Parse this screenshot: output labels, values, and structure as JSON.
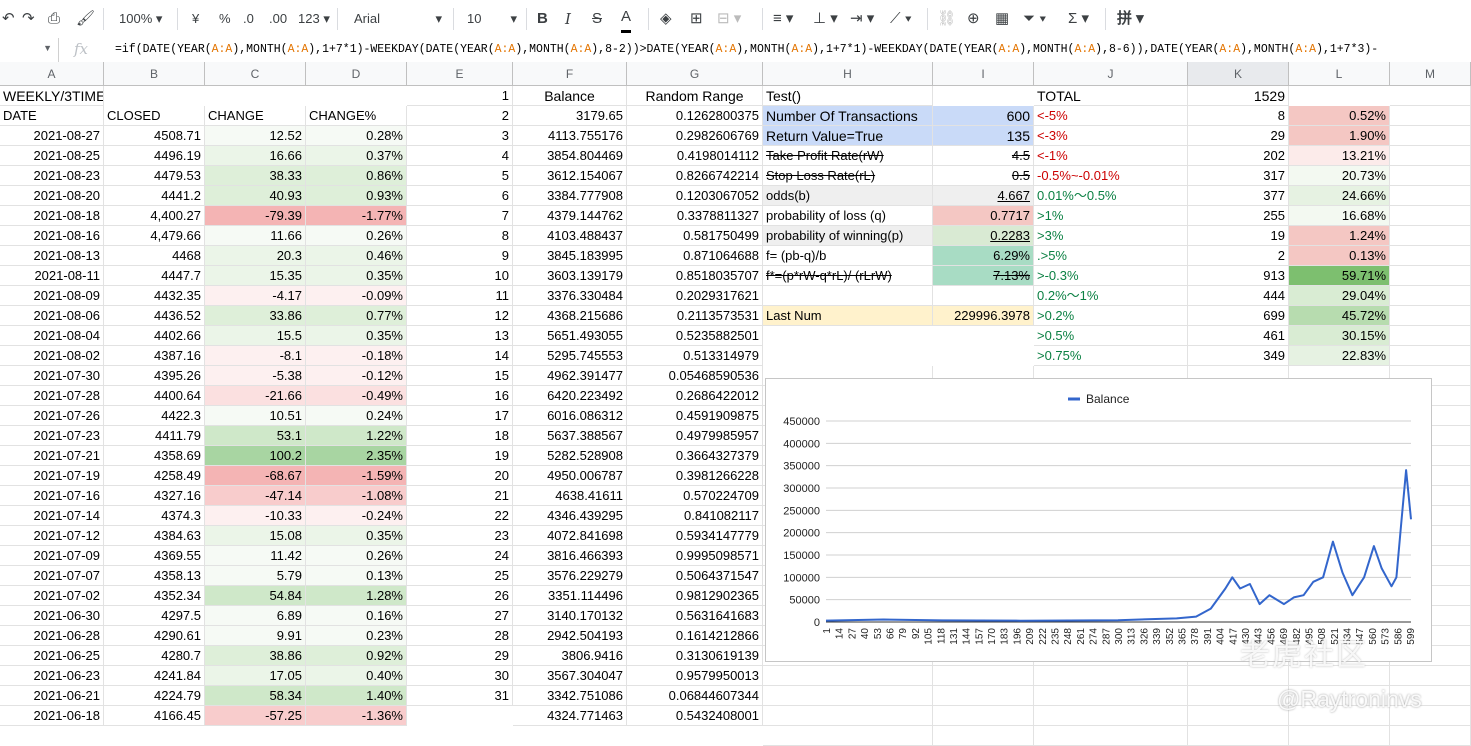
{
  "toolbar": {
    "zoom": "100%",
    "currency": "¥",
    "percent": "%",
    "dec_less": ".0",
    "dec_more": ".00",
    "more_formats": "123",
    "font": "Arial",
    "font_size": "10"
  },
  "formula_bar": {
    "fx": "fx",
    "formula": "=if(DATE(YEAR(A:A),MONTH(A:A),1+7*1)-WEEKDAY(DATE(YEAR(A:A),MONTH(A:A),8-2))>DATE(YEAR(A:A),MONTH(A:A),1+7*1)-WEEKDAY(DATE(YEAR(A:A),MONTH(A:A),8-6)),DATE(YEAR(A:A),MONTH(A:A),1+7*3)-"
  },
  "columns": [
    "A",
    "B",
    "C",
    "D",
    "E",
    "F",
    "G",
    "H",
    "I",
    "J",
    "K",
    "L",
    "M"
  ],
  "headers": {
    "a1": "WEEKLY/3TIMES",
    "a2": "DATE",
    "b2": "CLOSED",
    "c2": "CHANGE",
    "d2": "CHANGE%",
    "f1": "Balance",
    "g1": "Random Range",
    "h1": "Test()",
    "j1": "TOTAL",
    "k1": "1529"
  },
  "rows": [
    {
      "date": "2021-08-27",
      "closed": "4508.71",
      "change": "12.52",
      "pct": "0.28%",
      "n": "2",
      "bal": "4113.755176",
      "rnd": "0.2982606769"
    },
    {
      "date": "2021-08-25",
      "closed": "4496.19",
      "change": "16.66",
      "pct": "0.37%",
      "n": "3",
      "bal": "3854.804469",
      "rnd": "0.4198014112"
    },
    {
      "date": "2021-08-23",
      "closed": "4479.53",
      "change": "38.33",
      "pct": "0.86%",
      "n": "4",
      "bal": "3612.154067",
      "rnd": "0.8266742214"
    },
    {
      "date": "2021-08-20",
      "closed": "4441.2",
      "change": "40.93",
      "pct": "0.93%",
      "n": "5",
      "bal": "3384.777908",
      "rnd": "0.1203067052"
    },
    {
      "date": "2021-08-18",
      "closed": "4,400.27",
      "change": "-79.39",
      "pct": "-1.77%",
      "n": "6",
      "bal": "4379.144762",
      "rnd": "0.3378811327"
    },
    {
      "date": "2021-08-16",
      "closed": "4,479.66",
      "change": "11.66",
      "pct": "0.26%",
      "n": "7",
      "bal": "4103.488437",
      "rnd": "0.581750499"
    },
    {
      "date": "2021-08-13",
      "closed": "4468",
      "change": "20.3",
      "pct": "0.46%",
      "n": "8",
      "bal": "3845.183995",
      "rnd": "0.871064688"
    },
    {
      "date": "2021-08-11",
      "closed": "4447.7",
      "change": "15.35",
      "pct": "0.35%",
      "n": "9",
      "bal": "3603.139179",
      "rnd": "0.8518035707"
    },
    {
      "date": "2021-08-09",
      "closed": "4432.35",
      "change": "-4.17",
      "pct": "-0.09%",
      "n": "10",
      "bal": "3376.330484",
      "rnd": "0.2029317621"
    },
    {
      "date": "2021-08-06",
      "closed": "4436.52",
      "change": "33.86",
      "pct": "0.77%",
      "n": "11",
      "bal": "4368.215686",
      "rnd": "0.2113573531"
    },
    {
      "date": "2021-08-04",
      "closed": "4402.66",
      "change": "15.5",
      "pct": "0.35%",
      "n": "12",
      "bal": "5651.493055",
      "rnd": "0.5235882501"
    },
    {
      "date": "2021-08-02",
      "closed": "4387.16",
      "change": "-8.1",
      "pct": "-0.18%",
      "n": "13",
      "bal": "5295.745553",
      "rnd": "0.513314979"
    },
    {
      "date": "2021-07-30",
      "closed": "4395.26",
      "change": "-5.38",
      "pct": "-0.12%",
      "n": "14",
      "bal": "4962.391477",
      "rnd": "0.05468590536"
    },
    {
      "date": "2021-07-28",
      "closed": "4400.64",
      "change": "-21.66",
      "pct": "-0.49%",
      "n": "15",
      "bal": "6420.223492",
      "rnd": "0.2686422012"
    },
    {
      "date": "2021-07-26",
      "closed": "4422.3",
      "change": "10.51",
      "pct": "0.24%",
      "n": "16",
      "bal": "6016.086312",
      "rnd": "0.4591909875"
    },
    {
      "date": "2021-07-23",
      "closed": "4411.79",
      "change": "53.1",
      "pct": "1.22%",
      "n": "17",
      "bal": "5637.388567",
      "rnd": "0.4979985957"
    },
    {
      "date": "2021-07-21",
      "closed": "4358.69",
      "change": "100.2",
      "pct": "2.35%",
      "n": "18",
      "bal": "5282.528908",
      "rnd": "0.3664327379"
    },
    {
      "date": "2021-07-19",
      "closed": "4258.49",
      "change": "-68.67",
      "pct": "-1.59%",
      "n": "19",
      "bal": "4950.006787",
      "rnd": "0.3981266228"
    },
    {
      "date": "2021-07-16",
      "closed": "4327.16",
      "change": "-47.14",
      "pct": "-1.08%",
      "n": "20",
      "bal": "4638.41611",
      "rnd": "0.570224709"
    },
    {
      "date": "2021-07-14",
      "closed": "4374.3",
      "change": "-10.33",
      "pct": "-0.24%",
      "n": "21",
      "bal": "4346.439295",
      "rnd": "0.841082117"
    },
    {
      "date": "2021-07-12",
      "closed": "4384.63",
      "change": "15.08",
      "pct": "0.35%",
      "n": "22",
      "bal": "4072.841698",
      "rnd": "0.5934147779"
    },
    {
      "date": "2021-07-09",
      "closed": "4369.55",
      "change": "11.42",
      "pct": "0.26%",
      "n": "23",
      "bal": "3816.466393",
      "rnd": "0.9995098571"
    },
    {
      "date": "2021-07-07",
      "closed": "4358.13",
      "change": "5.79",
      "pct": "0.13%",
      "n": "24",
      "bal": "3576.229279",
      "rnd": "0.5064371547"
    },
    {
      "date": "2021-07-02",
      "closed": "4352.34",
      "change": "54.84",
      "pct": "1.28%",
      "n": "25",
      "bal": "3351.114496",
      "rnd": "0.9812902365"
    },
    {
      "date": "2021-06-30",
      "closed": "4297.5",
      "change": "6.89",
      "pct": "0.16%",
      "n": "26",
      "bal": "3140.170132",
      "rnd": "0.5631641683"
    },
    {
      "date": "2021-06-28",
      "closed": "4290.61",
      "change": "9.91",
      "pct": "0.23%",
      "n": "27",
      "bal": "2942.504193",
      "rnd": "0.1614212866"
    },
    {
      "date": "2021-06-25",
      "closed": "4280.7",
      "change": "38.86",
      "pct": "0.92%",
      "n": "28",
      "bal": "3806.9416",
      "rnd": "0.3130619139"
    },
    {
      "date": "2021-06-23",
      "closed": "4241.84",
      "change": "17.05",
      "pct": "0.40%",
      "n": "29",
      "bal": "3567.304047",
      "rnd": "0.9579950013"
    },
    {
      "date": "2021-06-21",
      "closed": "4224.79",
      "change": "58.34",
      "pct": "1.40%",
      "n": "30",
      "bal": "3342.751086",
      "rnd": "0.06844607344"
    },
    {
      "date": "2021-06-18",
      "closed": "4166.45",
      "change": "-57.25",
      "pct": "-1.36%",
      "n": "31",
      "bal": "4324.771463",
      "rnd": "0.5432408001"
    }
  ],
  "row1_e": "1",
  "row1_f": "3179.65",
  "row1_g": "0.1262800375",
  "params": [
    {
      "label": "Number Of Transactions",
      "value": "600"
    },
    {
      "label": "Return Value=True",
      "value": "135"
    },
    {
      "label": "Take Profit Rate(rW)",
      "value": "4.5"
    },
    {
      "label": "Stop Loss Rate(rL)",
      "value": "0.5"
    },
    {
      "label": "odds(b)",
      "value": "4.667"
    },
    {
      "label": "probability of loss (q)",
      "value": "0.7717"
    },
    {
      "label": "probability of winning(p)",
      "value": "0.2283"
    },
    {
      "label": "f=  (pb-q)/b",
      "value": "6.29%"
    },
    {
      "label": "f*=(p*rW-q*rL)/  (rLrW)",
      "value": "7.13%"
    },
    {
      "label": "",
      "value": ""
    },
    {
      "label": "Last Num",
      "value": "229996.3978"
    }
  ],
  "dist": [
    {
      "range": "<-5%",
      "count": "8",
      "pct": "0.52%"
    },
    {
      "range": "<-3%",
      "count": "29",
      "pct": "1.90%"
    },
    {
      "range": "<-1%",
      "count": "202",
      "pct": "13.21%"
    },
    {
      "range": "-0.5%~-0.01%",
      "count": "317",
      "pct": "20.73%"
    },
    {
      "range": "0.01%～0.5%",
      "count": "377",
      "pct": "24.66%"
    },
    {
      "range": ">1%",
      "count": "255",
      "pct": "16.68%"
    },
    {
      "range": ">3%",
      "count": "19",
      "pct": "1.24%"
    },
    {
      "range": ".>5%",
      "count": "2",
      "pct": "0.13%"
    },
    {
      "range": ">-0.3%",
      "count": "913",
      "pct": "59.71%"
    },
    {
      "range": "0.2%～1%",
      "count": "444",
      "pct": "29.04%"
    },
    {
      "range": ">0.2%",
      "count": "699",
      "pct": "45.72%"
    },
    {
      "range": ">0.5%",
      "count": "461",
      "pct": "30.15%"
    },
    {
      "range": ">0.75%",
      "count": "349",
      "pct": "22.83%"
    }
  ],
  "chart_data": {
    "type": "line",
    "legend": "Balance",
    "series": [
      {
        "name": "Balance",
        "color": "#3366cc"
      }
    ],
    "ylim": [
      0,
      450000
    ],
    "yticks": [
      "0",
      "50000",
      "100000",
      "150000",
      "200000",
      "250000",
      "300000",
      "350000",
      "400000",
      "450000"
    ],
    "xticks": [
      "1",
      "14",
      "27",
      "40",
      "53",
      "66",
      "79",
      "92",
      "105",
      "118",
      "131",
      "144",
      "157",
      "170",
      "183",
      "196",
      "209",
      "222",
      "235",
      "248",
      "261",
      "274",
      "287",
      "300",
      "313",
      "326",
      "339",
      "352",
      "365",
      "378",
      "391",
      "404",
      "417",
      "430",
      "443",
      "456",
      "469",
      "482",
      "495",
      "508",
      "521",
      "534",
      "547",
      "560",
      "573",
      "586",
      "599"
    ],
    "points": [
      [
        1,
        3180
      ],
      [
        60,
        5500
      ],
      [
        120,
        3500
      ],
      [
        200,
        3000
      ],
      [
        300,
        4000
      ],
      [
        360,
        8000
      ],
      [
        380,
        12000
      ],
      [
        395,
        30000
      ],
      [
        410,
        75000
      ],
      [
        417,
        100000
      ],
      [
        425,
        75000
      ],
      [
        435,
        85000
      ],
      [
        445,
        40000
      ],
      [
        455,
        60000
      ],
      [
        470,
        40000
      ],
      [
        480,
        55000
      ],
      [
        490,
        60000
      ],
      [
        500,
        90000
      ],
      [
        510,
        100000
      ],
      [
        520,
        180000
      ],
      [
        530,
        110000
      ],
      [
        540,
        60000
      ],
      [
        552,
        100000
      ],
      [
        562,
        170000
      ],
      [
        570,
        120000
      ],
      [
        580,
        80000
      ],
      [
        585,
        100000
      ],
      [
        590,
        220000
      ],
      [
        595,
        340000
      ],
      [
        600,
        230000
      ]
    ]
  },
  "watermark": {
    "cn": "老虎社区",
    "handle": "@Raytroninvs"
  }
}
